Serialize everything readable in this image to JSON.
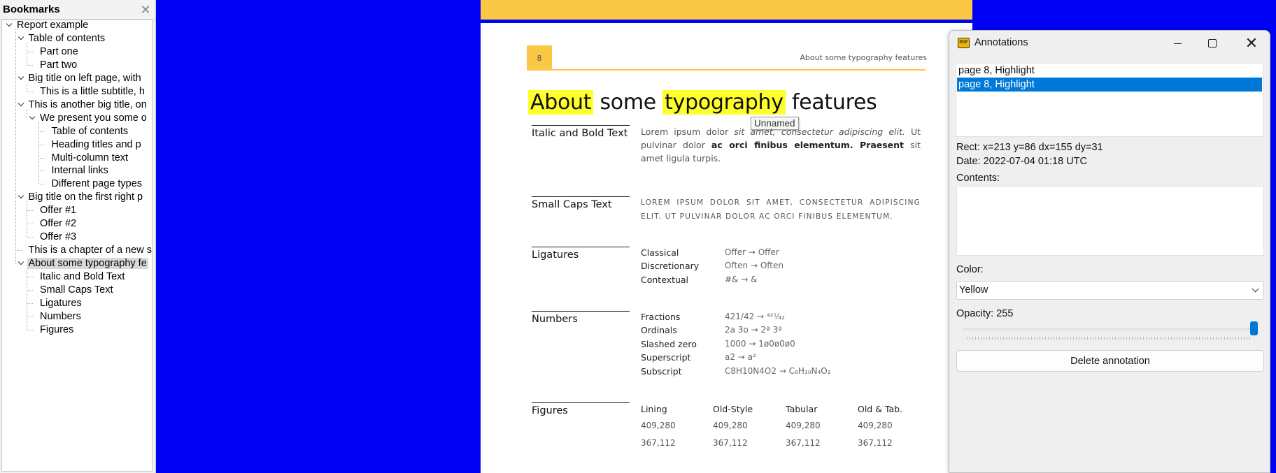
{
  "bookmarks_panel": {
    "title": "Bookmarks",
    "close_glyph": "✕",
    "rows": [
      {
        "label": "Report example",
        "level": 0,
        "expanded": true
      },
      {
        "label": "Table of contents",
        "level": 1,
        "expanded": true
      },
      {
        "label": "Part one",
        "level": 2
      },
      {
        "label": "Part two",
        "level": 2
      },
      {
        "label": "Big title on left page, with",
        "level": 1,
        "expanded": true
      },
      {
        "label": "This is a little subtitle, h",
        "level": 2
      },
      {
        "label": "This is another big title, on",
        "level": 1,
        "expanded": true
      },
      {
        "label": "We present you some o",
        "level": 2,
        "expanded": true
      },
      {
        "label": "Table of contents",
        "level": 3
      },
      {
        "label": "Heading titles and p",
        "level": 3
      },
      {
        "label": "Multi-column text",
        "level": 3
      },
      {
        "label": "Internal links",
        "level": 3
      },
      {
        "label": "Different page types",
        "level": 3
      },
      {
        "label": "Big title on the first right p",
        "level": 1,
        "expanded": true
      },
      {
        "label": "Offer #1",
        "level": 2
      },
      {
        "label": "Offer #2",
        "level": 2
      },
      {
        "label": "Offer #3",
        "level": 2
      },
      {
        "label": "This is a chapter of a new s",
        "level": 1
      },
      {
        "label": "About some typography fe",
        "level": 1,
        "expanded": true,
        "selected": true
      },
      {
        "label": "Italic and Bold Text",
        "level": 2
      },
      {
        "label": "Small Caps Text",
        "level": 2
      },
      {
        "label": "Ligatures",
        "level": 2
      },
      {
        "label": "Numbers",
        "level": 2
      },
      {
        "label": "Figures",
        "level": 2
      }
    ]
  },
  "document": {
    "page_number": "8",
    "running_header": "About some typography features",
    "heading": {
      "w1": "About",
      "w2": "some",
      "w3": "typography",
      "w4": "features"
    },
    "highlight_color": "#ffff2e",
    "tooltip": "Unnamed",
    "sections": {
      "italic_bold": {
        "title": "Italic and Bold Text",
        "p1": "Lorem ipsum dolor ",
        "p2": "sit amet, consectetur adipiscing elit.",
        "p3": " Ut pulvinar dolor ",
        "p4": "ac orci finibus elementum. Praesent",
        "p5": " sit amet ligula turpis."
      },
      "small_caps": {
        "title": "Small Caps Text",
        "text": "LOREM IPSUM DOLOR SIT AMET, CONSECTETUR ADIPISCING ELIT. UT PULVINAR DOLOR AC ORCI FINIBUS ELEMENTUM."
      },
      "ligatures": {
        "title": "Ligatures",
        "rows": [
          {
            "label": "Classical",
            "value": "Offer → Offer"
          },
          {
            "label": "Discretionary",
            "value": "Often → Often"
          },
          {
            "label": "Contextual",
            "value": "#& → &"
          }
        ]
      },
      "numbers": {
        "title": "Numbers",
        "rows": [
          {
            "label": "Fractions",
            "value": "421/42 → ⁴²¹⁄₄₂"
          },
          {
            "label": "Ordinals",
            "value": "2a 3o → 2ª 3º"
          },
          {
            "label": "Slashed zero",
            "value": "1000 → 1ø0ø0ø0"
          },
          {
            "label": "Superscript",
            "value": "a2 → a²"
          },
          {
            "label": "Subscript",
            "value": "C8H10N4O2 → C₈H₁₀N₄O₂"
          }
        ]
      },
      "figures": {
        "title": "Figures",
        "columns": [
          {
            "header": "Lining",
            "v1": "409,280",
            "v2": "367,112"
          },
          {
            "header": "Old-Style",
            "v1": "409,280",
            "v2": "367,112"
          },
          {
            "header": "Tabular",
            "v1": "409,280",
            "v2": "367,112"
          },
          {
            "header": "Old & Tab.",
            "v1": "409,280",
            "v2": "367,112"
          }
        ]
      }
    }
  },
  "annotations_window": {
    "title": "Annotations",
    "app_icon_text": "PDF",
    "list": [
      {
        "label": "page 8, Highlight",
        "selected": false
      },
      {
        "label": "page 8, Highlight",
        "selected": true
      }
    ],
    "rect": "Rect: x=213 y=86 dx=155 dy=31",
    "date": "Date: 2022-07-04 01:18 UTC",
    "contents_label": "Contents:",
    "contents_value": "",
    "color_label": "Color:",
    "color_value": "Yellow",
    "opacity_label": "Opacity: 255",
    "opacity_fraction": 1.0,
    "delete_label": "Delete annotation",
    "close_glyph": "✕"
  },
  "colors": {
    "background": "#0000f5",
    "page_accent": "#fbc845",
    "selection_blue": "#0078d7"
  }
}
